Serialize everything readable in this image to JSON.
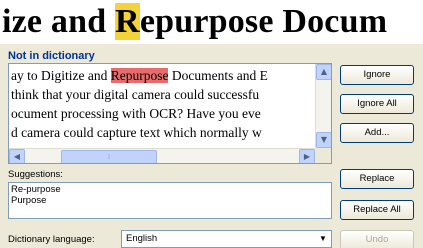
{
  "document": {
    "heading_prefix": "ize and ",
    "heading_highlight": "R",
    "heading_suffix": "epurpose Docum"
  },
  "dialog": {
    "not_in_dictionary_label": "Not in dictionary",
    "text_lines": {
      "line1_before": "ay to Digitize and ",
      "line1_error": "Repurpose",
      "line1_after": " Documents and E",
      "line2": " think that your digital camera could successfu",
      "line3": "ocument processing with OCR? Have you eve",
      "line4": "d camera could capture text which normally w"
    },
    "buttons": {
      "ignore": "Ignore",
      "ignore_all": "Ignore All",
      "add": "Add...",
      "replace": "Replace",
      "replace_all": "Replace All",
      "undo": "Undo"
    },
    "suggestions_label": "Suggestions:",
    "suggestions": [
      "Re-purpose",
      "Purpose"
    ],
    "dictionary_language_label": "Dictionary language:",
    "dictionary_language_value": "English"
  }
}
